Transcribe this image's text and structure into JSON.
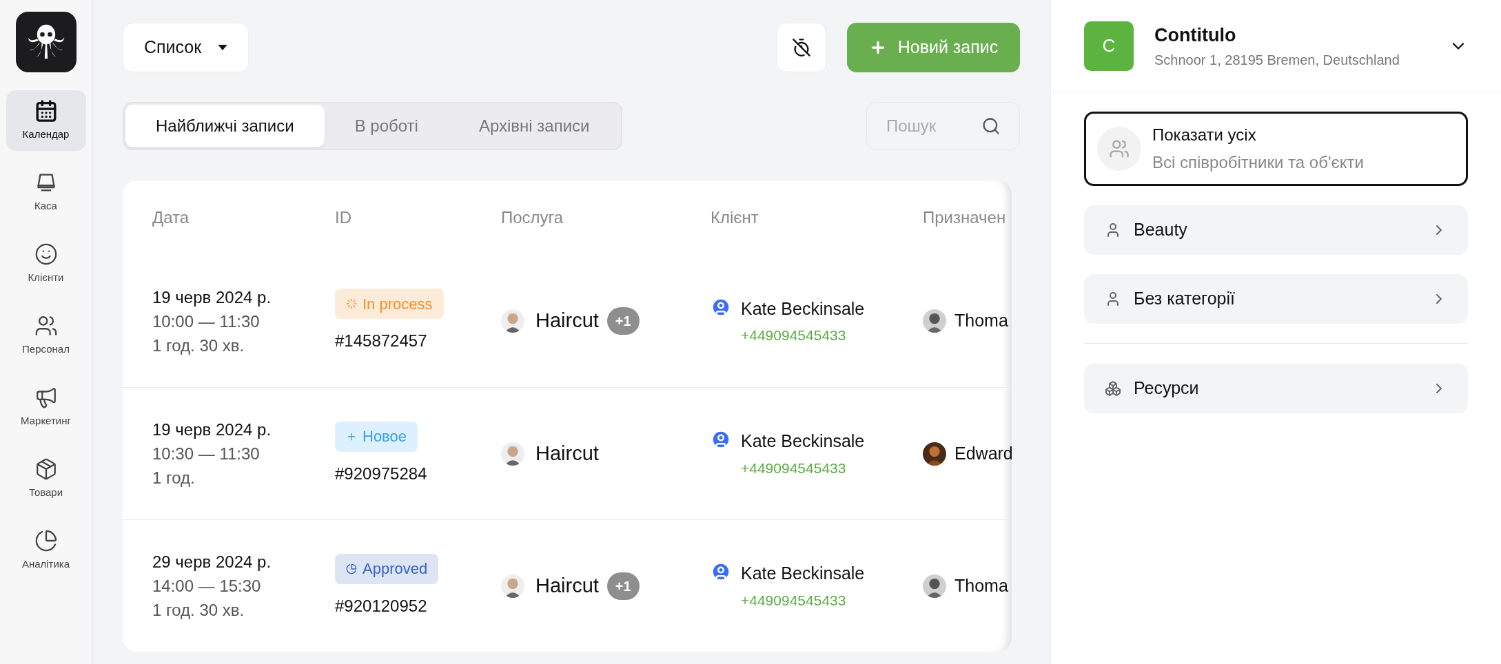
{
  "sidebar": {
    "items": [
      {
        "label": "Календар",
        "selected": true
      },
      {
        "label": "Каса",
        "selected": false
      },
      {
        "label": "Клієнти",
        "selected": false
      },
      {
        "label": "Персонал",
        "selected": false
      },
      {
        "label": "Маркетинг",
        "selected": false
      },
      {
        "label": "Товари",
        "selected": false
      },
      {
        "label": "Аналітика",
        "selected": false
      }
    ]
  },
  "toolbar": {
    "view_select": "Список",
    "new_button": "Новий запис"
  },
  "tabs": [
    {
      "label": "Найближчі записи",
      "selected": true
    },
    {
      "label": "В роботі",
      "selected": false
    },
    {
      "label": "Архівні записи",
      "selected": false
    }
  ],
  "search": {
    "placeholder": "Пошук"
  },
  "table": {
    "columns": [
      "Дата",
      "ID",
      "Послуга",
      "Клієнт",
      "Призначен"
    ],
    "rows": [
      {
        "date": "19 черв 2024 р.",
        "time": "10:00 — 11:30",
        "duration": "1 год. 30 хв.",
        "status": {
          "kind": "in_process",
          "label": "In process"
        },
        "id": "#145872457",
        "service": "Haircut",
        "extra": "+1",
        "client": "Kate Beckinsale",
        "phone": "+449094545433",
        "assignee": "Thoma"
      },
      {
        "date": "19 черв 2024 р.",
        "time": "10:30 — 11:30",
        "duration": "1 год.",
        "status": {
          "kind": "new",
          "label": "Новое"
        },
        "id": "#920975284",
        "service": "Haircut",
        "client": "Kate Beckinsale",
        "phone": "+449094545433",
        "assignee": "Edward"
      },
      {
        "date": "29 черв 2024 р.",
        "time": "14:00 — 15:30",
        "duration": "1 год. 30 хв.",
        "status": {
          "kind": "approved",
          "label": "Approved"
        },
        "id": "#920120952",
        "service": "Haircut",
        "extra": "+1",
        "client": "Kate Beckinsale",
        "phone": "+449094545433",
        "assignee": "Thoma"
      }
    ]
  },
  "panel": {
    "company": {
      "initial": "C",
      "name": "Contitulo",
      "address": "Schnoor 1, 28195 Bremen, Deutschland"
    },
    "show_all": {
      "title": "Показати усіх",
      "subtitle": "Всі співробітники та об'єкти",
      "selected": true
    },
    "groups": [
      {
        "label": "Beauty"
      },
      {
        "label": "Без категорії"
      }
    ],
    "resources": {
      "label": "Ресурси"
    }
  }
}
